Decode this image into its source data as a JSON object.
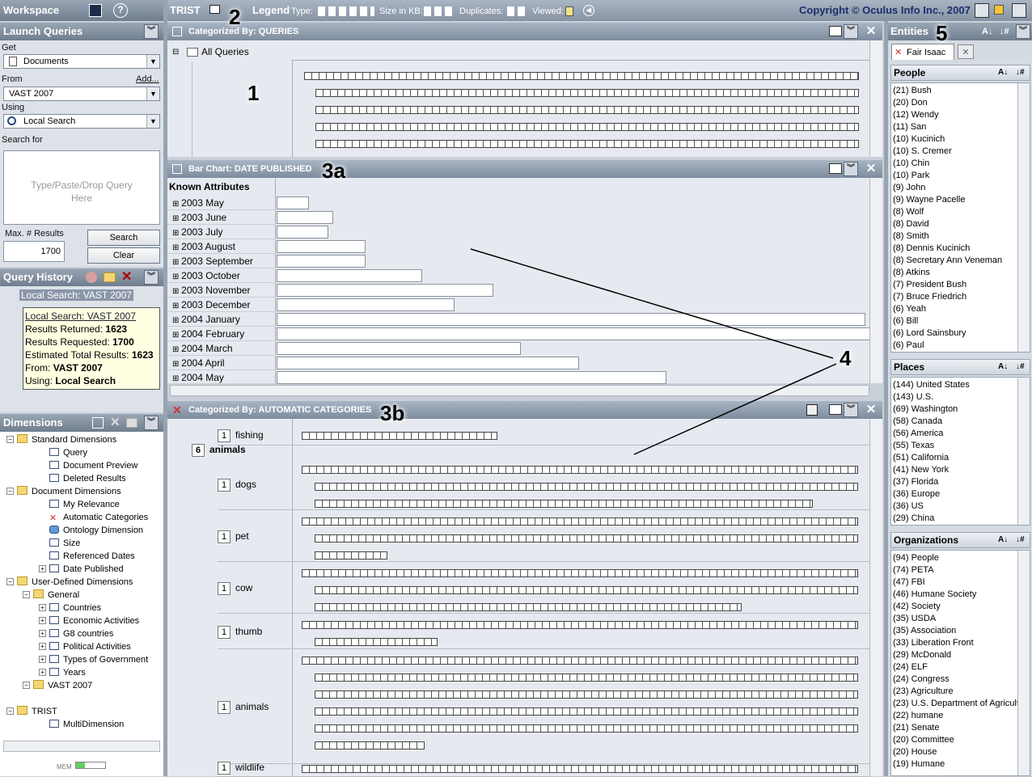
{
  "workspace": {
    "title": "Workspace"
  },
  "toolbar": {
    "app": "TRIST",
    "legend": "Legend",
    "type": "Type:",
    "size": "Size in KB:",
    "dups": "Duplicates:",
    "viewed": "Viewed:",
    "copyright": "Copyright © Oculus Info Inc., 2007"
  },
  "launch": {
    "title": "Launch Queries",
    "get_label": "Get",
    "get_value": "Documents",
    "from_label": "From",
    "from_add": "Add...",
    "from_value": "VAST 2007",
    "using_label": "Using",
    "using_value": "Local Search",
    "search_for": "Search for",
    "placeholder": "Type/Paste/Drop Query Here",
    "max_label": "Max. # Results",
    "max_value": "1700",
    "search_btn": "Search",
    "clear_btn": "Clear"
  },
  "history": {
    "title": "Query History",
    "item": "Local Search: VAST 2007",
    "tip_title": "Local Search: VAST 2007",
    "tip_returned_label": "Results Returned:",
    "tip_returned": "1623",
    "tip_requested_label": "Results Requested:",
    "tip_requested": "1700",
    "tip_estimated_label": "Estimated Total Results:",
    "tip_estimated": "1623",
    "tip_from_label": "From:",
    "tip_from": "VAST 2007",
    "tip_using_label": "Using:",
    "tip_using": "Local Search"
  },
  "dimensions": {
    "title": "Dimensions",
    "items": [
      "Standard Dimensions",
      "Query",
      "Document Preview",
      "Deleted Results",
      "Document Dimensions",
      "My Relevance",
      "Automatic Categories",
      "Ontology Dimension",
      "Size",
      "Referenced Dates",
      "Date Published",
      "User-Defined Dimensions",
      "General",
      "Countries",
      "Economic Activities",
      "G8 countries",
      "Political Activities",
      "Types of Government",
      "Years",
      "VAST 2007",
      "TRIST",
      "MultiDimension"
    ],
    "mem": "MEM"
  },
  "panels": {
    "queries_title": "Categorized By:  QUERIES",
    "all_queries": "All Queries",
    "bar_title": "Bar Chart:  DATE PUBLISHED",
    "known": "Known Attributes",
    "auto_title": "Categorized By:  AUTOMATIC CATEGORIES"
  },
  "chart_data": {
    "type": "bar",
    "categories": [
      "2003 May",
      "2003 June",
      "2003 July",
      "2003 August",
      "2003 September",
      "2003 October",
      "2003 November",
      "2003 December",
      "2004 January",
      "2004 February",
      "2004 March",
      "2004 April",
      "2004 May"
    ],
    "values": [
      40,
      70,
      64,
      110,
      110,
      180,
      268,
      220,
      728,
      740,
      302,
      374,
      482
    ]
  },
  "categories": [
    {
      "count": "1",
      "name": "fishing"
    },
    {
      "count": "6",
      "name": "animals"
    },
    {
      "count": "1",
      "name": "dogs"
    },
    {
      "count": "1",
      "name": "pet"
    },
    {
      "count": "1",
      "name": "cow"
    },
    {
      "count": "1",
      "name": "thumb"
    },
    {
      "count": "1",
      "name": "animals"
    },
    {
      "count": "1",
      "name": "wildlife"
    }
  ],
  "entities": {
    "title": "Entities",
    "tab": "Fair Isaac",
    "people_title": "People",
    "people": [
      "(21) Bush",
      "(20) Don",
      "(12) Wendy",
      "(11) San",
      "(10) Kucinich",
      "(10) S. Cremer",
      "(10) Chin",
      "(10) Park",
      "(9) John",
      "(9) Wayne Pacelle",
      "(8) Wolf",
      "(8) David",
      "(8) Smith",
      "(8) Dennis Kucinich",
      "(8) Secretary Ann Veneman",
      "(8) Atkins",
      "(7) President Bush",
      "(7) Bruce Friedrich",
      "(6) Yeah",
      "(6) Bill",
      "(6) Lord Sainsbury",
      "(6) Paul"
    ],
    "places_title": "Places",
    "places": [
      "(144) United States",
      "(143) U.S.",
      "(69) Washington",
      "(58) Canada",
      "(56) America",
      "(55) Texas",
      "(51) California",
      "(41) New York",
      "(37) Florida",
      "(36) Europe",
      "(36) US",
      "(29) China"
    ],
    "orgs_title": "Organizations",
    "orgs": [
      "(94) People",
      "(74) PETA",
      "(47) FBI",
      "(46) Humane Society",
      "(42) Society",
      "(35) USDA",
      "(35) Association",
      "(33) Liberation Front",
      "(29) McDonald",
      "(24) ELF",
      "(24) Congress",
      "(23) Agriculture",
      "(23) U.S. Department of Agricult",
      "(22) humane",
      "(21) Senate",
      "(20) Committee",
      "(20) House",
      "(19) Humane"
    ]
  },
  "annotations": {
    "n1": "1",
    "n2": "2",
    "n3a": "3a",
    "n3b": "3b",
    "n4": "4",
    "n5": "5"
  }
}
